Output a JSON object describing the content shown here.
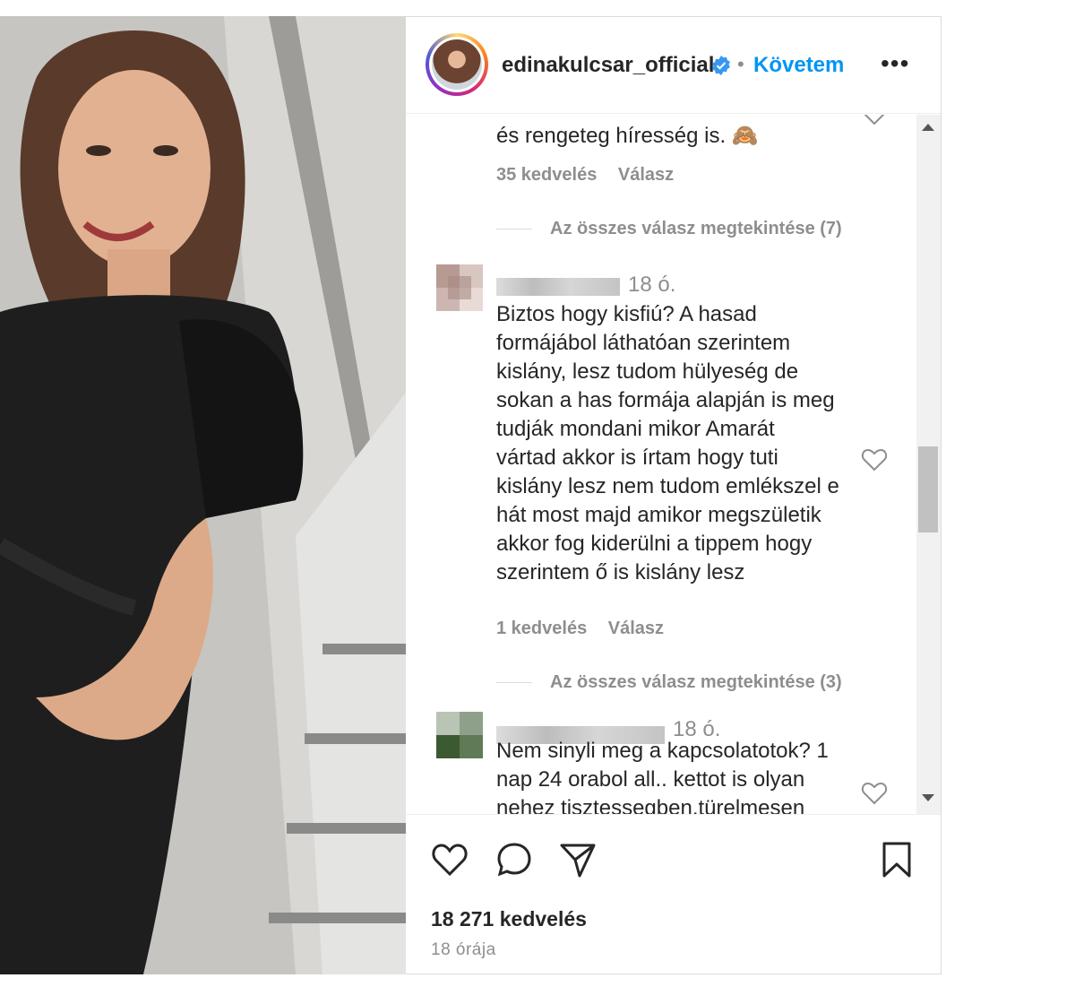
{
  "post": {
    "username": "edinakulcsar_official",
    "follow_label": "Követem",
    "separator": "•",
    "more_label": "•••"
  },
  "comments": [
    {
      "text": "és rengeteg híresség is. 🙈",
      "likes": "35 kedvelés",
      "reply": "Válasz",
      "view_replies": "Az összes válasz megtekintése (7)"
    },
    {
      "time": "18 ó.",
      "text_lines": [
        "Biztos hogy kisfiú? A hasad",
        "formájábol láthatóan szerintem",
        "kislány, lesz tudom hülyeség de",
        "sokan a has formája alapján is meg",
        "tudják mondani mikor Amarát",
        "vártad akkor is írtam hogy tuti",
        "kislány lesz nem tudom emlékszel e",
        "hát most majd amikor megszületik",
        "akkor fog kiderülni a tippem hogy",
        "szerintem ő is kislány lesz"
      ],
      "likes": "1 kedvelés",
      "reply": "Válasz",
      "view_replies": "Az összes válasz megtekintése (3)"
    },
    {
      "time": "18 ó.",
      "text_lines": [
        "Nem sinyli meg a kapcsolatotok? 1",
        "nap 24 orabol all.. kettot is olyan",
        "nehez tisztessegben.türelmesen"
      ]
    }
  ],
  "footer": {
    "likes": "18 271 kedvelés",
    "time_ago": "18 órája"
  },
  "colors": {
    "accent": "#0095f6",
    "text": "#262626",
    "secondary": "#8e8e8e"
  },
  "icons": [
    "verified-badge-icon",
    "heart-icon",
    "comment-icon",
    "share-icon",
    "bookmark-icon",
    "more-icon"
  ]
}
